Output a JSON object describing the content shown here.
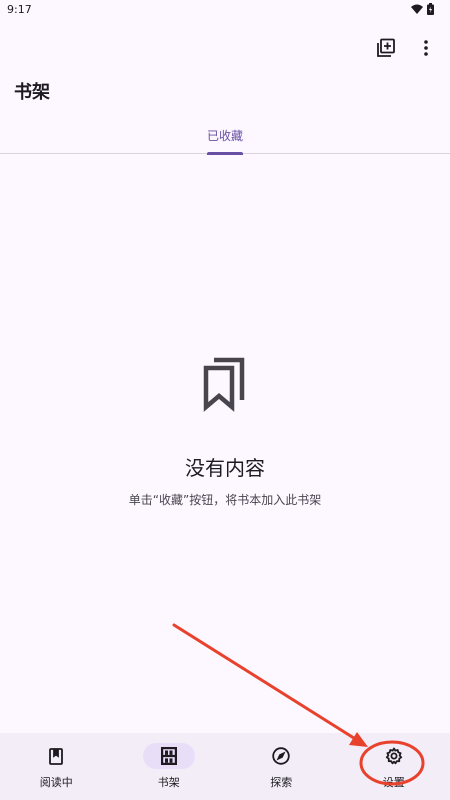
{
  "status_bar": {
    "time": "9:17"
  },
  "header": {
    "title": "书架"
  },
  "tabs": [
    {
      "label": "已收藏",
      "active": true
    }
  ],
  "empty_state": {
    "title": "没有内容",
    "description": "单击“收藏”按钮，将书本加入此书架"
  },
  "bottom_nav": {
    "items": [
      {
        "label": "阅读中",
        "icon": "book-icon"
      },
      {
        "label": "书架",
        "icon": "bookshelf-icon",
        "active": true
      },
      {
        "label": "探索",
        "icon": "compass-icon"
      },
      {
        "label": "设置",
        "icon": "gear-icon"
      }
    ]
  },
  "colors": {
    "background": "#fdf7ff",
    "accent": "#6750a4",
    "nav_background": "#f3edf7",
    "active_pill": "#e8def8",
    "annotation": "#e8412c"
  }
}
